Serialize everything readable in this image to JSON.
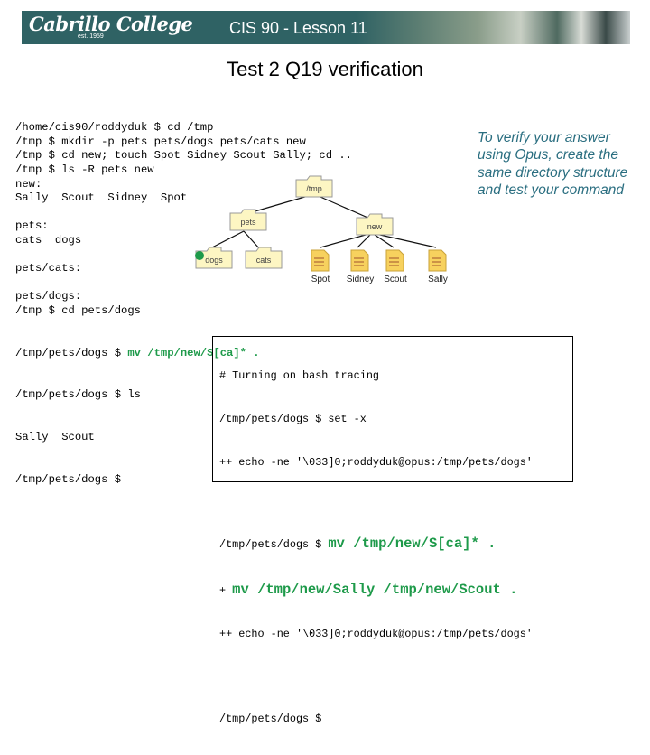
{
  "header": {
    "logo": "Cabrillo College",
    "logo_est": "est. 1959",
    "lesson": "CIS 90 - Lesson 11"
  },
  "title": "Test 2 Q19 verification",
  "terminal": {
    "lines": [
      "/home/cis90/roddyduk $ cd /tmp",
      "/tmp $ mkdir -p pets pets/dogs pets/cats new",
      "/tmp $ cd new; touch Spot Sidney Scout Sally; cd ..",
      "/tmp $ ls -R pets new",
      "new:",
      "Sally  Scout  Sidney  Spot",
      "",
      "pets:",
      "cats  dogs",
      "",
      "pets/cats:",
      "",
      "pets/dogs:",
      "/tmp $ cd pets/dogs"
    ],
    "mv_prompt": "/tmp/pets/dogs $ ",
    "mv_cmd": "mv /tmp/new/S[ca]* .",
    "after": [
      "/tmp/pets/dogs $ ls",
      "Sally  Scout",
      "/tmp/pets/dogs $"
    ]
  },
  "note": "To verify your answer using Opus, create the same directory structure and test your command",
  "tree": {
    "root": "/tmp",
    "pets": "pets",
    "new": "new",
    "dogs": "dogs",
    "cats": "cats",
    "files": [
      "Spot",
      "Sidney",
      "Scout",
      "Sally"
    ]
  },
  "trace": {
    "l1": "# Turning on bash tracing",
    "l2": "/tmp/pets/dogs $ set -x",
    "l3": "++ echo -ne '\\033]0;roddyduk@opus:/tmp/pets/dogs'",
    "l4_prompt": "/tmp/pets/dogs $ ",
    "l4_cmd": "mv /tmp/new/S[ca]* .",
    "l5_plus": "+ ",
    "l5_cmd": "mv /tmp/new/Sally /tmp/new/Scout .",
    "l6": "++ echo -ne '\\033]0;roddyduk@opus:/tmp/pets/dogs'",
    "l7": "/tmp/pets/dogs $"
  },
  "colors": {
    "banner": "#2f6264",
    "green": "#1e9a4a",
    "note": "#2a6e80",
    "folder": "#fdf6c3"
  }
}
